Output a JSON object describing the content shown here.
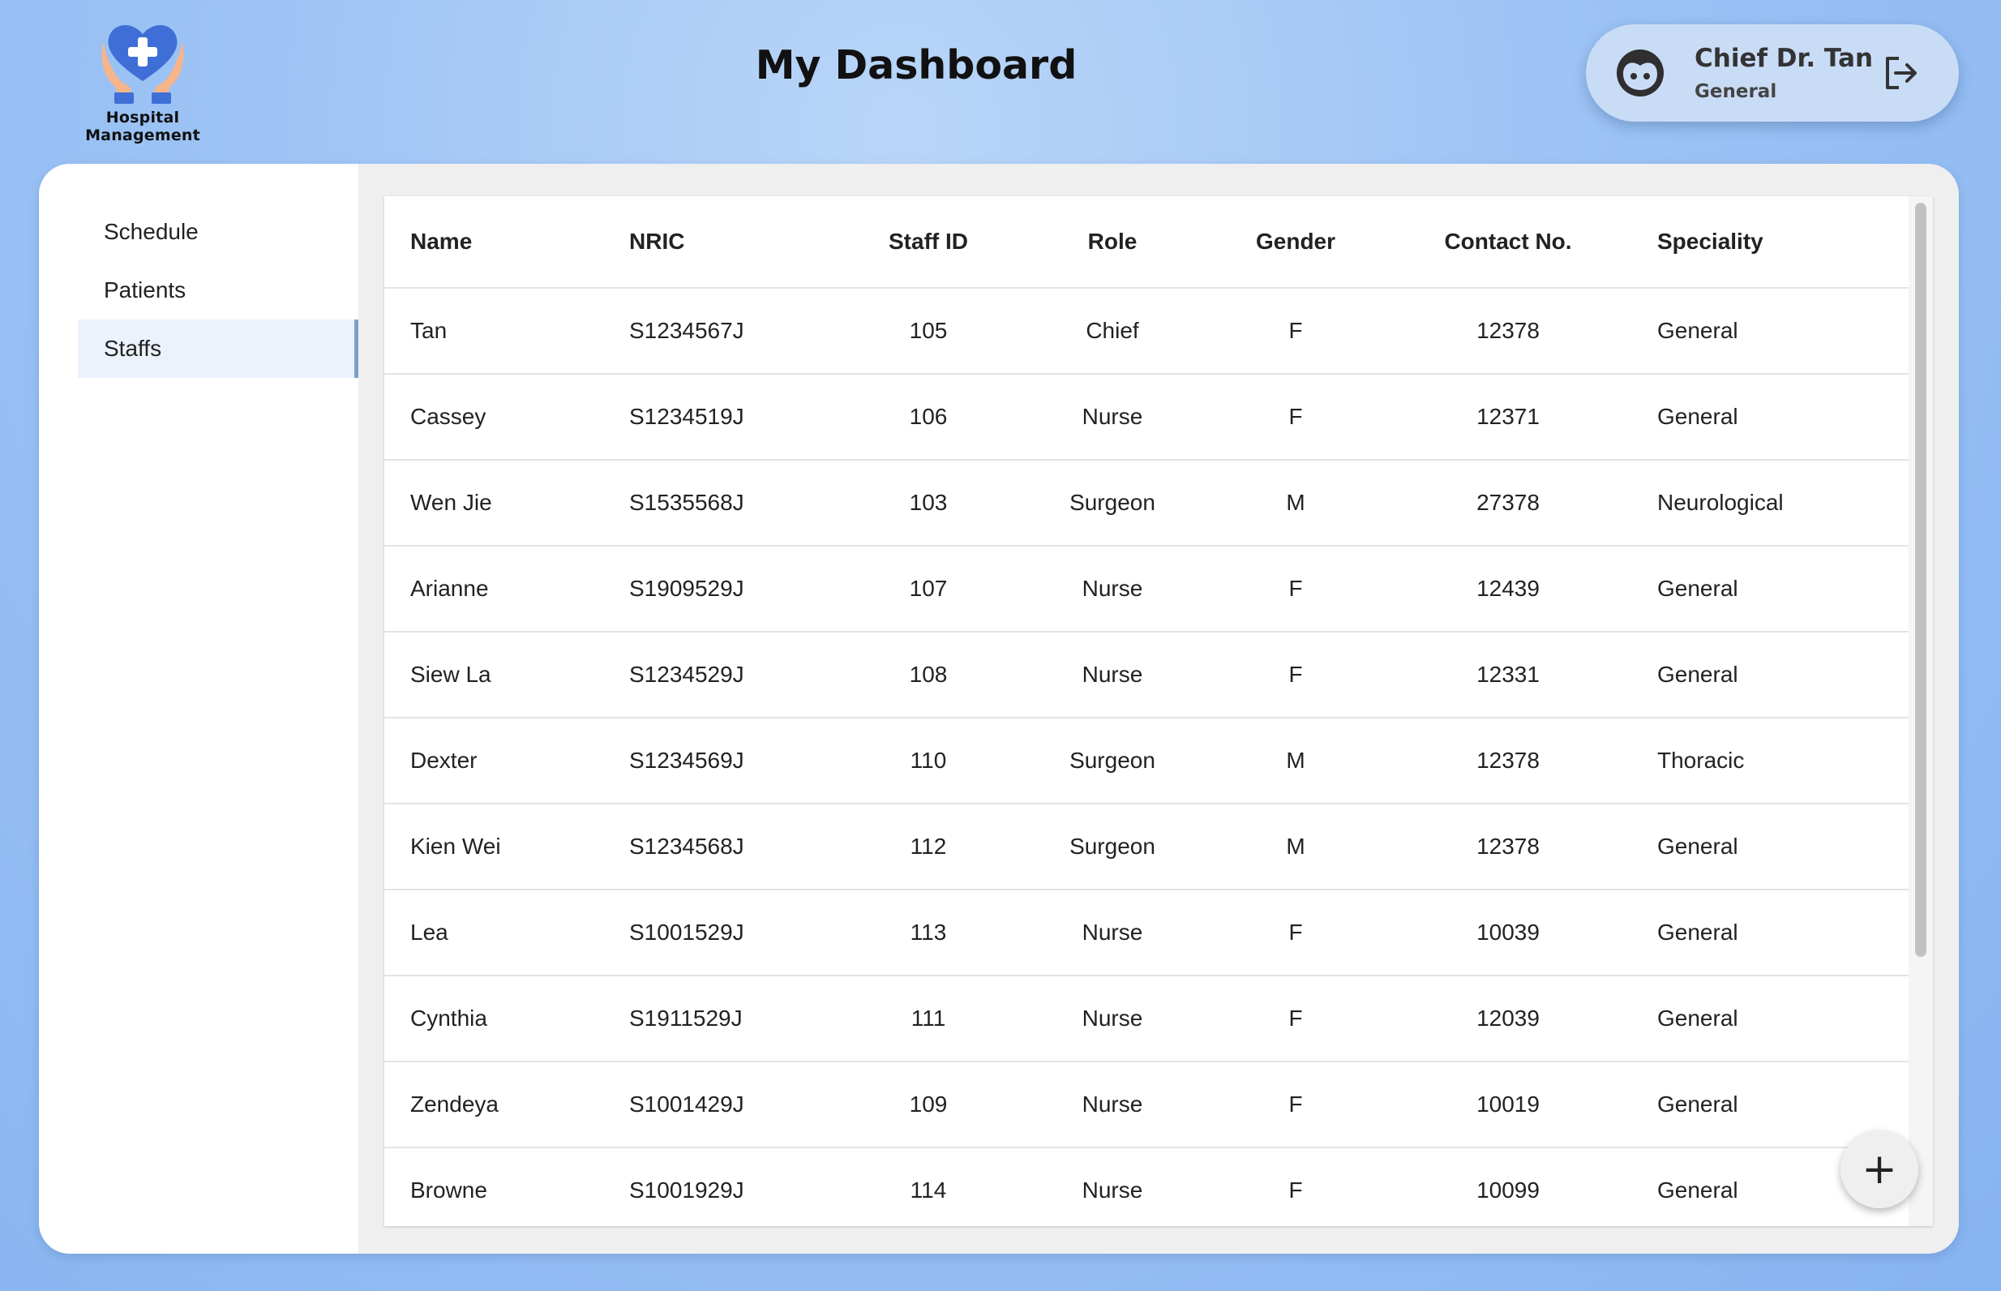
{
  "app": {
    "logo_text": "Hospital Management",
    "logo_icon": "heart-cross-hands-icon"
  },
  "header": {
    "title": "My Dashboard"
  },
  "profile": {
    "name": "Chief Dr. Tan",
    "department": "General",
    "avatar_icon": "user-face-icon",
    "logout_icon": "logout-icon"
  },
  "sidebar": {
    "items": [
      {
        "label": "Schedule"
      },
      {
        "label": "Patients"
      },
      {
        "label": "Staffs",
        "active": true
      }
    ]
  },
  "table": {
    "columns": [
      "Name",
      "NRIC",
      "Staff ID",
      "Role",
      "Gender",
      "Contact No.",
      "Speciality"
    ],
    "rows": [
      [
        "Tan",
        "S1234567J",
        "105",
        "Chief",
        "F",
        "12378",
        "General"
      ],
      [
        "Cassey",
        "S1234519J",
        "106",
        "Nurse",
        "F",
        "12371",
        "General"
      ],
      [
        "Wen Jie",
        "S1535568J",
        "103",
        "Surgeon",
        "M",
        "27378",
        "Neurological"
      ],
      [
        "Arianne",
        "S1909529J",
        "107",
        "Nurse",
        "F",
        "12439",
        "General"
      ],
      [
        "Siew La",
        "S1234529J",
        "108",
        "Nurse",
        "F",
        "12331",
        "General"
      ],
      [
        "Dexter",
        "S1234569J",
        "110",
        "Surgeon",
        "M",
        "12378",
        "Thoracic"
      ],
      [
        "Kien Wei",
        "S1234568J",
        "112",
        "Surgeon",
        "M",
        "12378",
        "General"
      ],
      [
        "Lea",
        "S1001529J",
        "113",
        "Nurse",
        "F",
        "10039",
        "General"
      ],
      [
        "Cynthia",
        "S1911529J",
        "111",
        "Nurse",
        "F",
        "12039",
        "General"
      ],
      [
        "Zendeya",
        "S1001429J",
        "109",
        "Nurse",
        "F",
        "10019",
        "General"
      ],
      [
        "Browne",
        "S1001929J",
        "114",
        "Nurse",
        "F",
        "10099",
        "General"
      ]
    ]
  },
  "fab": {
    "label": "+",
    "icon": "plus-icon"
  },
  "colors": {
    "accent": "#4a7fe0",
    "active_nav_bg": "#ecf2fb",
    "active_nav_border": "#7c9fc8"
  }
}
